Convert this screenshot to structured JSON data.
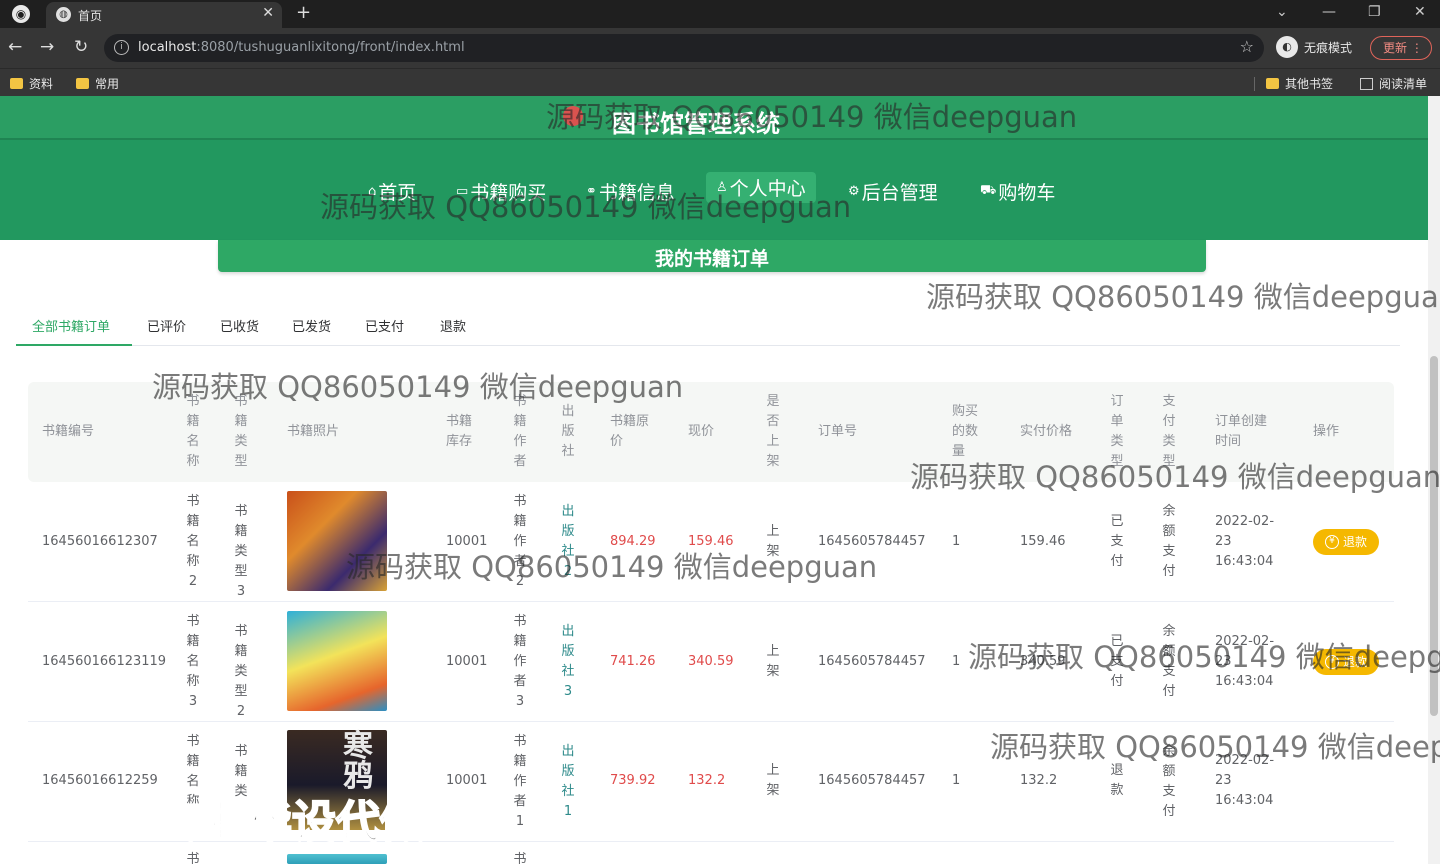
{
  "browser": {
    "tab_title": "首页",
    "url_host": "localhost",
    "url_path": ":8080/tushuguanlixitong/front/index.html",
    "incognito_label": "无痕模式",
    "update_label": "更新",
    "bookmarks": [
      "资料",
      "常用"
    ],
    "bookmarks_right": [
      "其他书签",
      "阅读清单"
    ]
  },
  "site": {
    "title": "图书馆管理系统",
    "nav": [
      {
        "icon": "home-icon",
        "label": "首页"
      },
      {
        "icon": "book-icon",
        "label": "书籍购买"
      },
      {
        "icon": "link-icon",
        "label": "书籍信息"
      },
      {
        "icon": "user-icon",
        "label": "个人中心"
      },
      {
        "icon": "gear-icon",
        "label": "后台管理"
      },
      {
        "icon": "cart-icon",
        "label": "购物车"
      }
    ],
    "section_title": "我的书籍订单"
  },
  "order_tabs": [
    "全部书籍订单",
    "已评价",
    "已收货",
    "已发货",
    "已支付",
    "退款"
  ],
  "table": {
    "headers": [
      "书籍编号",
      "书籍名称",
      "书籍类型",
      "书籍照片",
      "书籍库存",
      "书籍作者",
      "出版社",
      "书籍原价",
      "现价",
      "是否上架",
      "订单号",
      "购买的数量",
      "实付价格",
      "订单类型",
      "支付类型",
      "订单创建时间",
      "操作"
    ],
    "rows": [
      {
        "id": "16456016612307",
        "name": "书籍名称2",
        "type": "书籍类型3",
        "stock": "10001",
        "author": "书籍作者2",
        "publisher": "出版社2",
        "orig": "894.29",
        "price": "159.46",
        "onsale": "上架",
        "order_no": "1645605784457",
        "qty": "1",
        "paid": "159.46",
        "order_type": "已支付",
        "pay_type": "余额支付",
        "time": "2022-02-23 16:43:04",
        "action": "退款"
      },
      {
        "id": "164560166123119",
        "name": "书籍名称3",
        "type": "书籍类型2",
        "stock": "10001",
        "author": "书籍作者3",
        "publisher": "出版社3",
        "orig": "741.26",
        "price": "340.59",
        "onsale": "上架",
        "order_no": "1645605784457",
        "qty": "1",
        "paid": "340.59",
        "order_type": "已支付",
        "pay_type": "余额支付",
        "time": "2022-02-23 16:43:04",
        "action": "退款"
      },
      {
        "id": "16456016612259",
        "name": "书籍名称",
        "type": "书籍类",
        "stock": "10001",
        "author": "书籍作者1",
        "publisher": "出版社1",
        "orig": "739.92",
        "price": "132.2",
        "onsale": "上架",
        "order_no": "1645605784457",
        "qty": "1",
        "paid": "132.2",
        "order_type": "退款",
        "pay_type": "余额支付",
        "time": "2022-02-23 16:43:04",
        "action": ""
      }
    ],
    "partial_row": {
      "name": "书",
      "author": "书"
    },
    "image_caption_row3": "寒鸦"
  },
  "watermarks": {
    "text": "源码获取 QQ86050149 微信deepguan",
    "bottom": "专业毕设代做"
  }
}
